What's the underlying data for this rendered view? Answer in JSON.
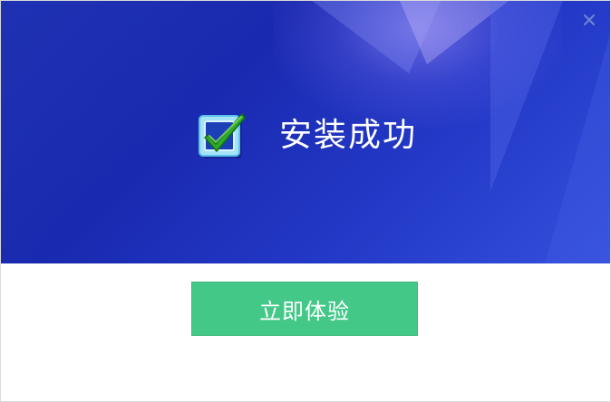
{
  "window": {
    "close_label": "×"
  },
  "banner": {
    "title": "安装成功",
    "icon": "checkbox-checked-icon"
  },
  "footer": {
    "primary_button_label": "立即体验"
  },
  "colors": {
    "banner_start": "#1f31b3",
    "banner_end": "#3550dd",
    "button_green": "#44c888",
    "check_green": "#2ea82a",
    "checkbox_frame": "#7fd3f2"
  }
}
